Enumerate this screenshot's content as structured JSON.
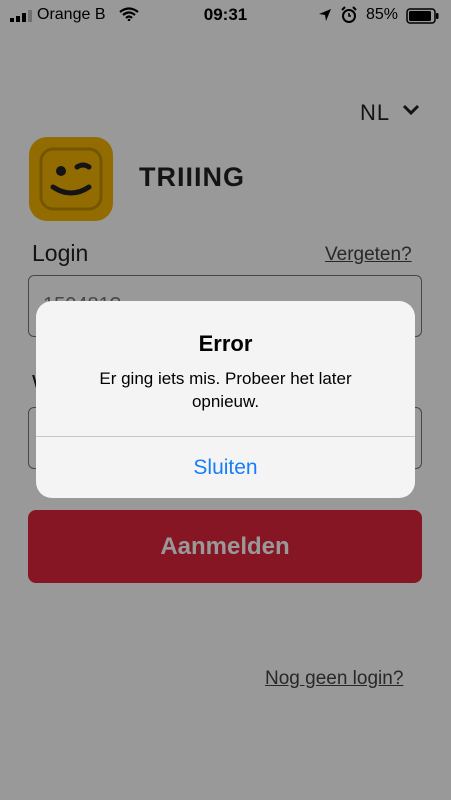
{
  "status_bar": {
    "carrier": "Orange B",
    "time": "09:31",
    "battery": "85%",
    "icons": [
      "signal-icon",
      "wifi-icon",
      "location-arrow-icon",
      "alarm-icon",
      "battery-icon"
    ]
  },
  "app": {
    "language": "NL",
    "brand": "TRIIING",
    "login_label": "Login",
    "forgot_link": "Vergeten?",
    "login_value": "150481?",
    "login_button": "Aanmelden",
    "no_login_link": "Nog geen login?",
    "colors": {
      "brand_yellow": "#f4b400",
      "primary_red": "#e2263f"
    }
  },
  "alert": {
    "title": "Error",
    "message": "Er ging iets mis. Probeer het later opnieuw.",
    "button": "Sluiten",
    "button_color": "#157efb"
  }
}
